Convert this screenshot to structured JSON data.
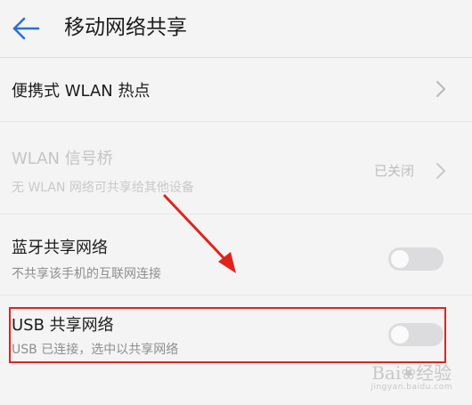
{
  "header": {
    "title": "移动网络共享",
    "back_icon": "arrow-left-icon"
  },
  "rows": {
    "hotspot": {
      "title": "便携式 WLAN 热点"
    },
    "wlan_bridge": {
      "title": "WLAN 信号桥",
      "subtitle": "无 WLAN 网络可共享给其他设备",
      "status": "已关闭"
    },
    "bluetooth": {
      "title": "蓝牙共享网络",
      "subtitle": "不共享该手机的互联网连接",
      "enabled": false
    },
    "usb": {
      "title": "USB 共享网络",
      "subtitle": "USB 已连接，选中以共享网络",
      "enabled": false
    }
  },
  "annotation": {
    "highlight_color": "#e0231c"
  },
  "watermark": {
    "logo": "Bai❀经验",
    "url": "jingyan.baidu.com"
  },
  "colors": {
    "accent": "#2a6fdb",
    "background": "#f4f4f5",
    "toggle_off": "#dcdcdf"
  }
}
